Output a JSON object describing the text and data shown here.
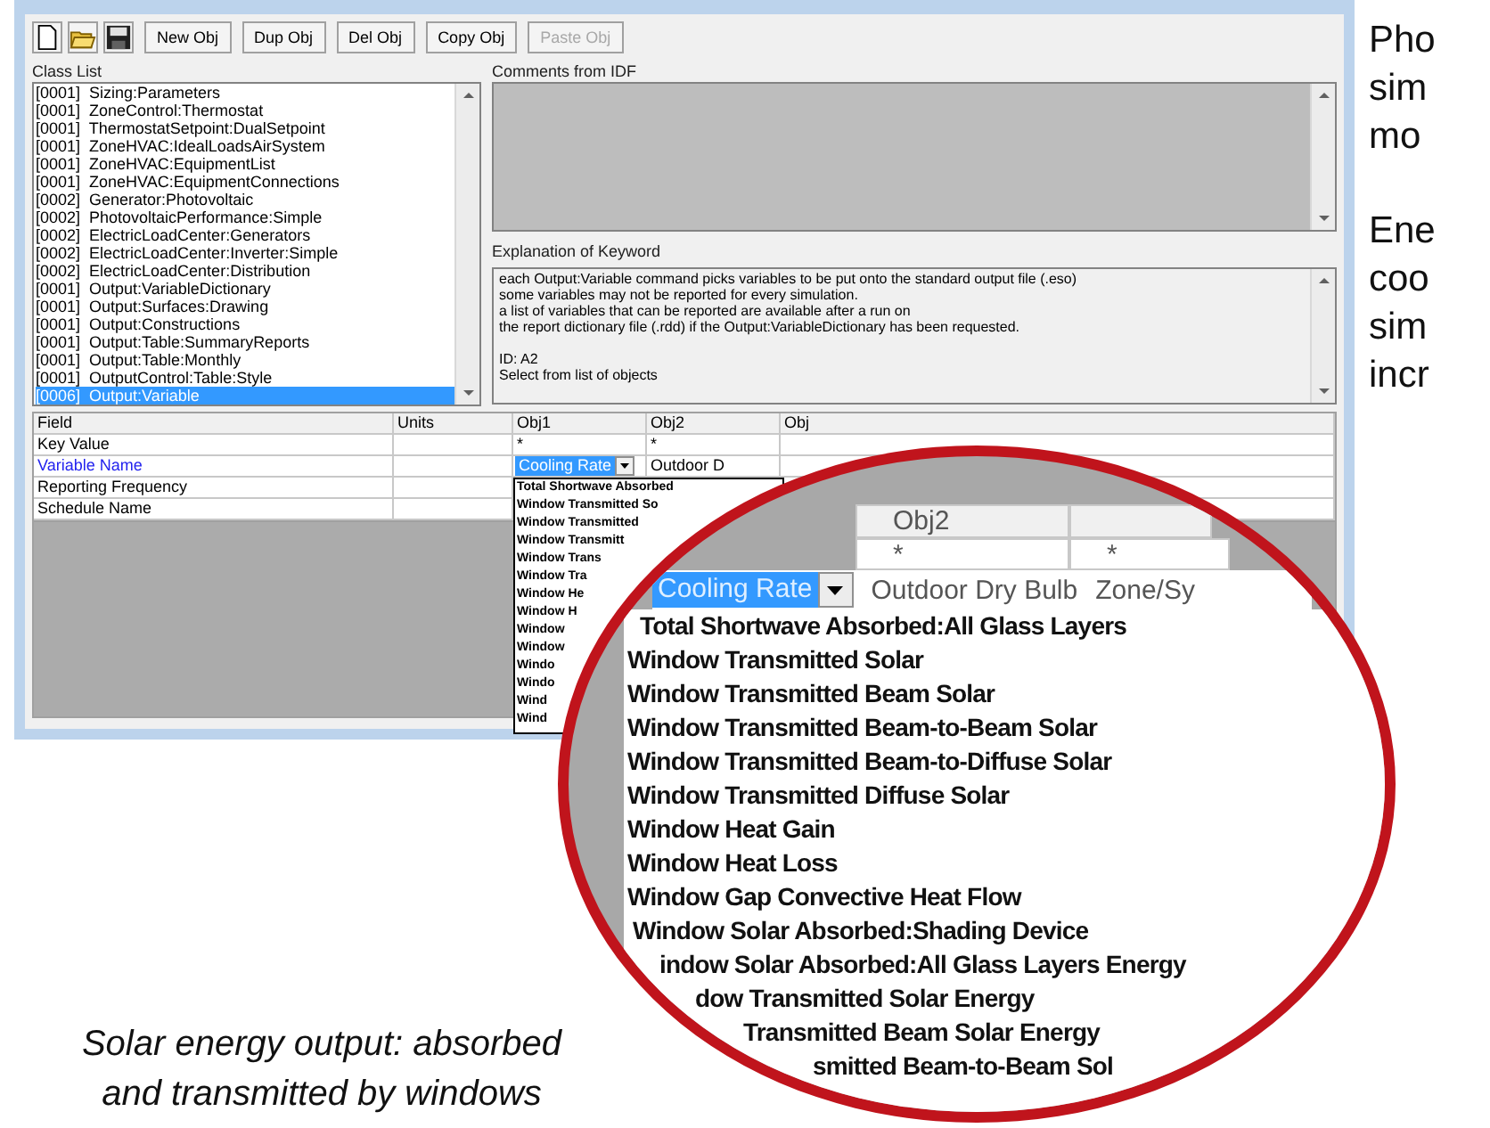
{
  "window": {
    "toolbar_buttons": [
      {
        "label": "New Obj",
        "disabled": false
      },
      {
        "label": "Dup Obj",
        "disabled": false
      },
      {
        "label": "Del Obj",
        "disabled": false
      },
      {
        "label": "Copy Obj",
        "disabled": false
      },
      {
        "label": "Paste Obj",
        "disabled": true
      }
    ],
    "class_list": {
      "label": "Class List",
      "items": [
        {
          "text": "[0001]  Sizing:Parameters",
          "selected": false
        },
        {
          "text": "[0001]  ZoneControl:Thermostat",
          "selected": false
        },
        {
          "text": "[0001]  ThermostatSetpoint:DualSetpoint",
          "selected": false
        },
        {
          "text": "[0001]  ZoneHVAC:IdealLoadsAirSystem",
          "selected": false
        },
        {
          "text": "[0001]  ZoneHVAC:EquipmentList",
          "selected": false
        },
        {
          "text": "[0001]  ZoneHVAC:EquipmentConnections",
          "selected": false
        },
        {
          "text": "[0002]  Generator:Photovoltaic",
          "selected": false
        },
        {
          "text": "[0002]  PhotovoltaicPerformance:Simple",
          "selected": false
        },
        {
          "text": "[0002]  ElectricLoadCenter:Generators",
          "selected": false
        },
        {
          "text": "[0002]  ElectricLoadCenter:Inverter:Simple",
          "selected": false
        },
        {
          "text": "[0002]  ElectricLoadCenter:Distribution",
          "selected": false
        },
        {
          "text": "[0001]  Output:VariableDictionary",
          "selected": false
        },
        {
          "text": "[0001]  Output:Surfaces:Drawing",
          "selected": false
        },
        {
          "text": "[0001]  Output:Constructions",
          "selected": false
        },
        {
          "text": "[0001]  Output:Table:SummaryReports",
          "selected": false
        },
        {
          "text": "[0001]  Output:Table:Monthly",
          "selected": false
        },
        {
          "text": "[0001]  OutputControl:Table:Style",
          "selected": false
        },
        {
          "text": "[0006]  Output:Variable",
          "selected": true
        }
      ]
    },
    "comments": {
      "label": "Comments from IDF"
    },
    "explanation": {
      "label": "Explanation of Keyword",
      "paragraphs": [
        [
          "each Output:Variable command picks variables to be put onto the standard output file (.eso)",
          "some variables may not be reported for every simulation.",
          "a list of variables that can be reported are available after a run on",
          "the report dictionary file (.rdd) if the Output:VariableDictionary has been requested."
        ],
        [
          "ID: A2",
          "Select from list of objects"
        ]
      ]
    },
    "table": {
      "columns": [
        "Field",
        "Units",
        "Obj1",
        "Obj2",
        "Obj"
      ],
      "rows": [
        {
          "field": "Key Value",
          "selected": false,
          "kind": "text",
          "obj_values": [
            "*",
            "*"
          ]
        },
        {
          "field": "Variable Name",
          "selected": true,
          "kind": "combo",
          "obj_values": [
            "Cooling Rate",
            "Outdoor D"
          ]
        },
        {
          "field": "Reporting Frequency",
          "selected": false
        },
        {
          "field": "Schedule Name",
          "selected": false
        }
      ]
    },
    "dropdown_options": [
      "Total Shortwave Absorbed",
      "Window Transmitted So",
      "Window Transmitted",
      "Window Transmitt",
      "Window Trans",
      "Window Tra",
      "Window He",
      "Window H",
      "Window",
      "Window",
      "Windo",
      "Windo",
      "Wind",
      "Wind"
    ]
  },
  "magnifier": {
    "header": "Obj2",
    "key_values": [
      "*",
      "*"
    ],
    "combo_value": "Cooling Rate",
    "other_values": [
      "Outdoor Dry Bulb",
      "Zone/Sy"
    ],
    "options": [
      "Total Shortwave Absorbed:All Glass Layers",
      "Window Transmitted Solar",
      "Window Transmitted Beam Solar",
      "Window Transmitted Beam-to-Beam Solar",
      "Window Transmitted Beam-to-Diffuse Solar",
      "Window Transmitted Diffuse Solar",
      "Window Heat Gain",
      "Window Heat Loss",
      "Window Gap Convective Heat Flow",
      "Window Solar Absorbed:Shading Device",
      "indow Solar Absorbed:All Glass Layers Energy",
      "dow Transmitted Solar Energy",
      "Transmitted Beam Solar Energy",
      "smitted Beam-to-Beam Sol"
    ]
  },
  "side_notes": [
    {
      "lines": [
        "Pho",
        "sim",
        "mo"
      ]
    },
    {
      "lines": [
        "Ene",
        "coo",
        "sim",
        "incr"
      ]
    }
  ],
  "caption": {
    "lines": [
      "Solar energy output: absorbed",
      "and transmitted by windows"
    ]
  }
}
